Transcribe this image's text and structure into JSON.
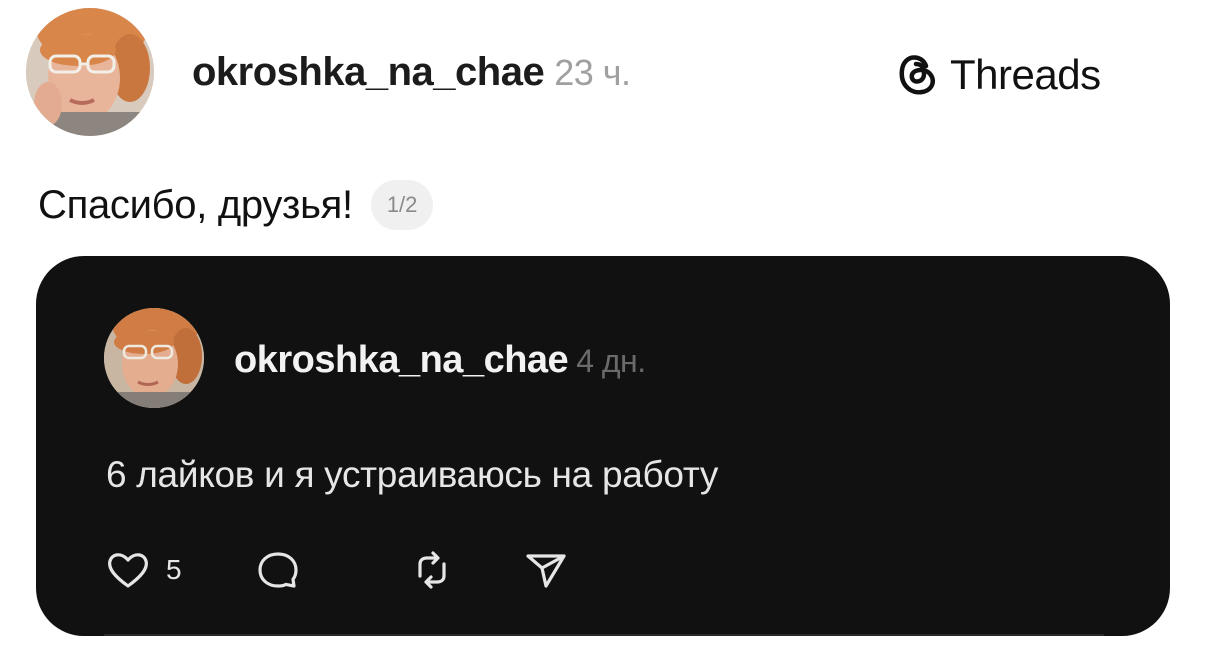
{
  "post": {
    "author": "okroshka_na_chae",
    "time": "23 ч.",
    "caption": "Спасибо, друзья!",
    "counter": "1/2"
  },
  "brand": {
    "name": "Threads",
    "icon": "threads-logo-icon"
  },
  "embedded_post": {
    "author": "okroshka_na_chae",
    "time": "4 дн.",
    "text": "6 лайков и я устраиваюсь на работу",
    "likes": "5",
    "actions": [
      "heart-icon",
      "comment-icon",
      "repost-icon",
      "share-icon"
    ]
  },
  "colors": {
    "card_background": "#111111",
    "muted_text": "#a0a0a0"
  }
}
